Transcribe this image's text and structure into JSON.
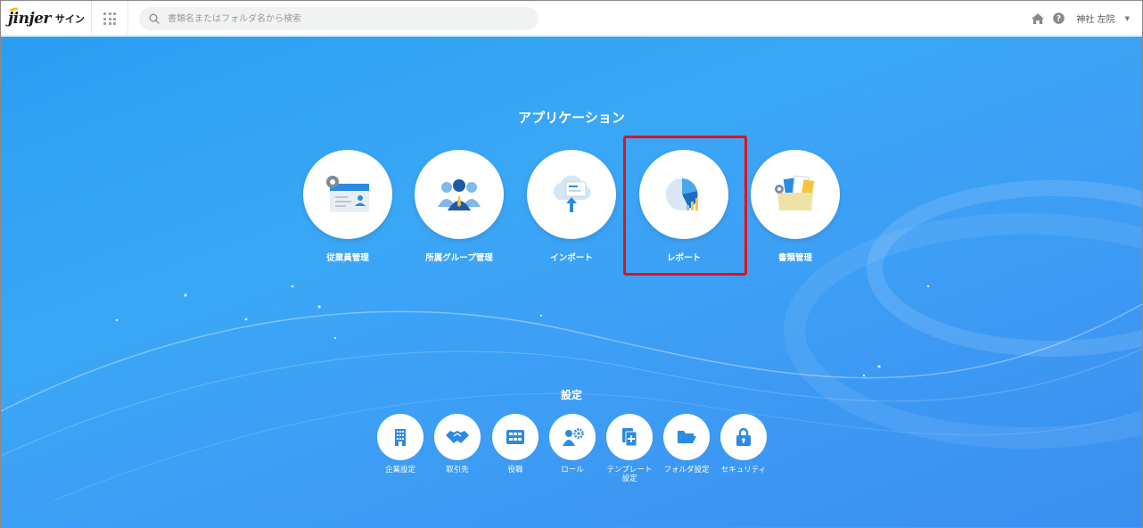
{
  "header": {
    "logo_text": "jinjer",
    "logo_sub": "サイン",
    "search_placeholder": "書類名またはフォルダ名から検索",
    "user_name": "神社 左院",
    "icons": [
      "apps-grid-icon",
      "search-icon",
      "home-icon",
      "help-icon",
      "caret-down-icon"
    ]
  },
  "applications": {
    "title": "アプリケーション",
    "items": [
      {
        "label": "従業員管理",
        "icon": "employee-card-icon"
      },
      {
        "label": "所属グループ管理",
        "icon": "group-people-icon"
      },
      {
        "label": "インポート",
        "icon": "cloud-upload-icon"
      },
      {
        "label": "レポート",
        "icon": "pie-chart-icon"
      },
      {
        "label": "書類管理",
        "icon": "document-folder-icon"
      }
    ],
    "highlighted": "レポート",
    "highlight_color": "#e0131b"
  },
  "settings": {
    "title": "設定",
    "items": [
      {
        "label": "企業設定",
        "icon": "building-icon"
      },
      {
        "label": "取引先",
        "icon": "handshake-icon"
      },
      {
        "label": "役職",
        "icon": "org-chart-icon"
      },
      {
        "label": "ロール",
        "icon": "role-gear-icon"
      },
      {
        "label": "テンプレート設定",
        "icon": "template-docs-icon"
      },
      {
        "label": "フォルダ設定",
        "icon": "folder-open-icon"
      },
      {
        "label": "セキュリティ",
        "icon": "lock-icon"
      }
    ]
  },
  "colors": {
    "background": "#3aa7f6",
    "icon_blue": "#2a8be0",
    "accent_yellow": "#f5c542"
  }
}
